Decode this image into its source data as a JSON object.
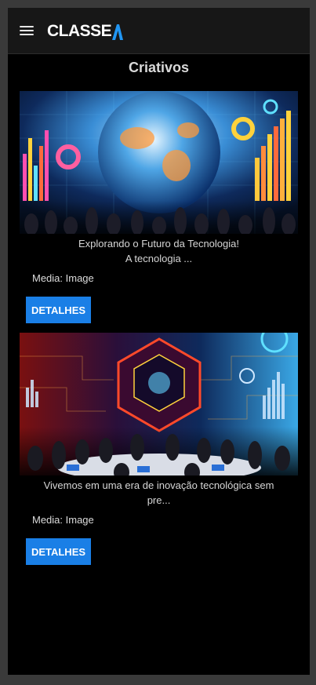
{
  "header": {
    "brand_text": "CLASSE",
    "icons": {
      "menu": "hamburger-menu-icon",
      "logo_mark": "stylized-a-mark"
    },
    "colors": {
      "bar": "#171717",
      "logo_accent": "#2196f3"
    }
  },
  "page": {
    "title": "Criativos"
  },
  "cards": [
    {
      "caption_line1": "Explorando o Futuro da Tecnologia!",
      "caption_line2": "A tecnologia ...",
      "media": "Media: Image",
      "button": "DETALHES"
    },
    {
      "caption_line1": "Vivemos em uma era de inovação tecnológica sem",
      "caption_line2": "pre...",
      "media": "Media: Image",
      "button": "DETALHES"
    }
  ],
  "colors": {
    "button": "#1a7fe6",
    "background": "#000000"
  }
}
